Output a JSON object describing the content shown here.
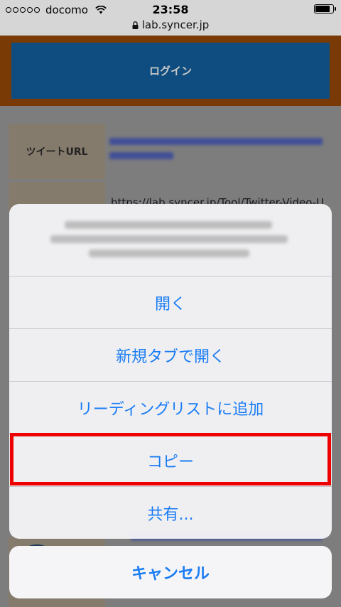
{
  "status_bar": {
    "carrier": "docomo",
    "time": "23:58",
    "url": "lab.syncer.jp",
    "battery_level": 0.9
  },
  "page": {
    "login_label": "ログイン",
    "row1_label": "ツイートURL",
    "video_url": "https://lab.syncer.jp/Tool/Twitter-Video-U"
  },
  "action_sheet": {
    "items": [
      "開く",
      "新規タブで開く",
      "リーディングリストに追加",
      "コピー",
      "共有..."
    ],
    "cancel_label": "キャンセル"
  },
  "colors": {
    "accent": "#1a7cf4",
    "highlight": "#ee0000",
    "login_button": "#1a73c8",
    "login_border": "#c55a0b"
  },
  "icons": [
    "wifi-icon",
    "lock-icon",
    "battery-icon"
  ]
}
